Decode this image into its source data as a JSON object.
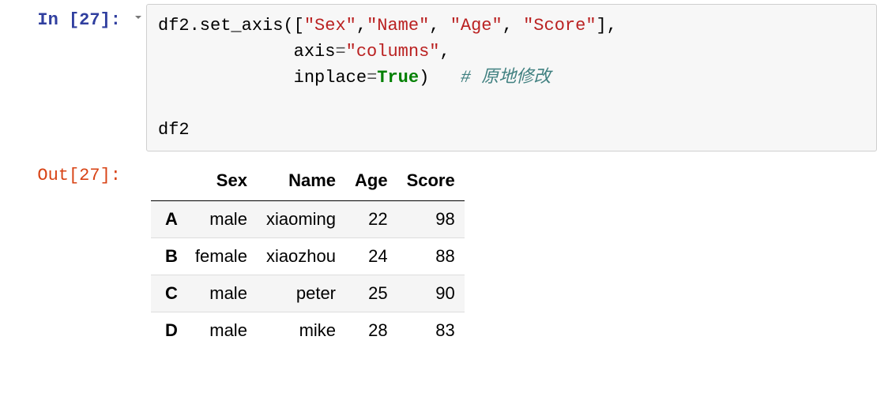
{
  "input": {
    "prompt_label": "In [27]:",
    "code_tokens": {
      "line1_pre": "df2.set_axis([",
      "s1": "\"Sex\"",
      "c1": ",",
      "s2": "\"Name\"",
      "c2": ", ",
      "s3": "\"Age\"",
      "c3": ", ",
      "s4": "\"Score\"",
      "line1_post": "],",
      "line2_indent": "             ",
      "line2_kwarg": "axis",
      "line2_eq": "=",
      "line2_val": "\"columns\"",
      "line2_post": ",",
      "line3_indent": "             ",
      "line3_kwarg": "inplace",
      "line3_eq": "=",
      "line3_val": "True",
      "line3_post": ")   ",
      "line3_comment": "# 原地修改",
      "line5": "df2"
    }
  },
  "output": {
    "prompt_label": "Out[27]:",
    "columns": [
      "Sex",
      "Name",
      "Age",
      "Score"
    ],
    "index": [
      "A",
      "B",
      "C",
      "D"
    ],
    "rows": [
      {
        "Sex": "male",
        "Name": "xiaoming",
        "Age": "22",
        "Score": "98"
      },
      {
        "Sex": "female",
        "Name": "xiaozhou",
        "Age": "24",
        "Score": "88"
      },
      {
        "Sex": "male",
        "Name": "peter",
        "Age": "25",
        "Score": "90"
      },
      {
        "Sex": "male",
        "Name": "mike",
        "Age": "28",
        "Score": "83"
      }
    ]
  }
}
